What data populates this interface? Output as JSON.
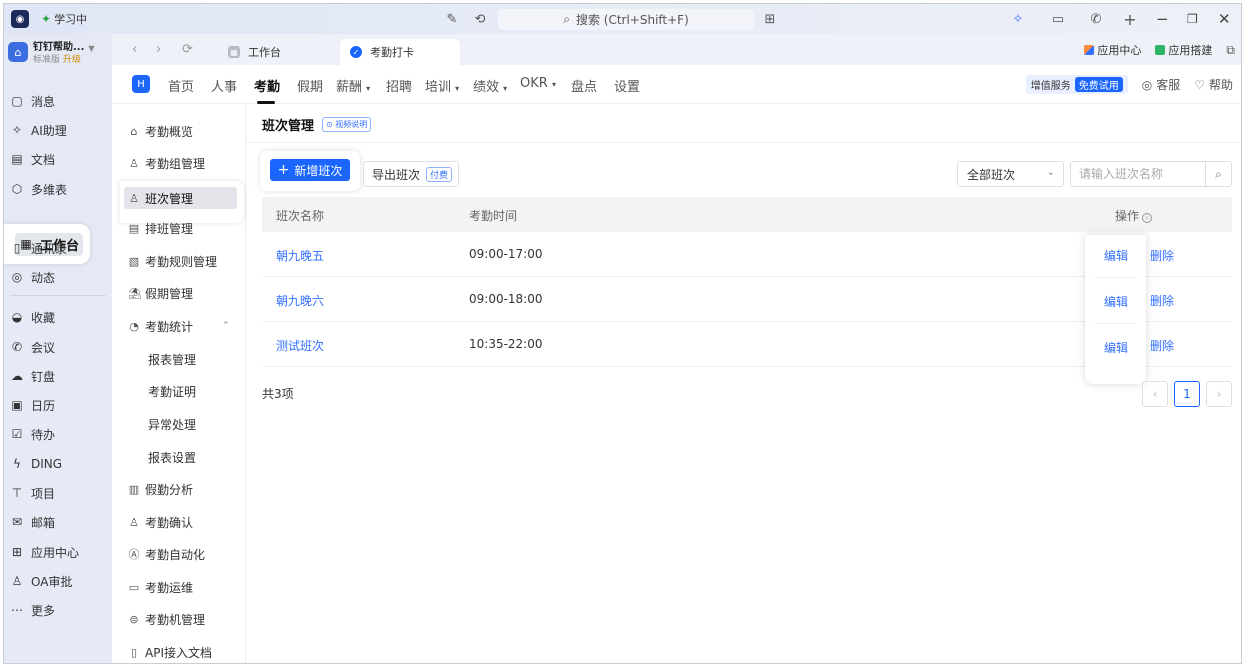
{
  "titlebar": {
    "study_label": "学习中",
    "search_text": "搜索 (Ctrl+Shift+F)"
  },
  "org": {
    "name": "钉钉帮助...",
    "plan": "标准版",
    "upgrade": "升级"
  },
  "leftnav": {
    "items": [
      {
        "label": "消息",
        "icon": "chat-icon"
      },
      {
        "label": "AI助理",
        "icon": "ai-spark-icon"
      },
      {
        "label": "文档",
        "icon": "doc-icon"
      },
      {
        "label": "多维表",
        "icon": "table-icon"
      },
      {
        "label": "工作台",
        "icon": "grid-icon"
      },
      {
        "label": "通讯录",
        "icon": "contacts-icon"
      },
      {
        "label": "动态",
        "icon": "activity-icon"
      },
      {
        "label": "收藏",
        "icon": "bookmark-icon"
      },
      {
        "label": "会议",
        "icon": "meeting-icon"
      },
      {
        "label": "钉盘",
        "icon": "cloud-icon"
      },
      {
        "label": "日历",
        "icon": "calendar-icon"
      },
      {
        "label": "待办",
        "icon": "todo-icon"
      },
      {
        "label": "DING",
        "icon": "ding-icon"
      },
      {
        "label": "项目",
        "icon": "project-icon"
      },
      {
        "label": "邮箱",
        "icon": "mail-icon"
      },
      {
        "label": "应用中心",
        "icon": "apps-icon"
      },
      {
        "label": "OA审批",
        "icon": "approval-icon"
      },
      {
        "label": "更多",
        "icon": "more-icon"
      }
    ]
  },
  "tabs": [
    {
      "label": "工作台"
    },
    {
      "label": "考勤打卡"
    }
  ],
  "tabs_right": {
    "app_center": "应用中心",
    "app_builder": "应用搭建"
  },
  "modnav": {
    "items": [
      "首页",
      "人事",
      "考勤",
      "假期",
      "薪酬",
      "招聘",
      "培训",
      "绩效",
      "OKR",
      "盘点",
      "设置"
    ],
    "value_added": "增值服务",
    "free_trial": "免费试用",
    "service": "客服",
    "help": "帮助"
  },
  "subnav": {
    "items": [
      {
        "label": "考勤概览",
        "icon": "home-icon"
      },
      {
        "label": "考勤组管理",
        "icon": "group-icon"
      },
      {
        "label": "班次管理",
        "icon": "shift-icon"
      },
      {
        "label": "排班管理",
        "icon": "schedule-icon"
      },
      {
        "label": "考勤规则管理",
        "icon": "rule-icon"
      },
      {
        "label": "假期管理",
        "icon": "holiday-icon"
      },
      {
        "label": "考勤统计",
        "icon": "stats-icon"
      },
      {
        "label": "报表管理"
      },
      {
        "label": "考勤证明"
      },
      {
        "label": "异常处理"
      },
      {
        "label": "报表设置"
      },
      {
        "label": "假勤分析",
        "icon": "analysis-icon"
      },
      {
        "label": "考勤确认",
        "icon": "confirm-icon"
      },
      {
        "label": "考勤自动化",
        "icon": "automation-icon"
      },
      {
        "label": "考勤运维",
        "icon": "ops-icon"
      },
      {
        "label": "考勤机管理",
        "icon": "device-icon"
      },
      {
        "label": "API接入文档",
        "icon": "api-icon"
      }
    ]
  },
  "content": {
    "title": "班次管理",
    "video_link": "⊙ 视频说明",
    "add_button": "新增班次",
    "export_button": "导出班次",
    "paid_tag": "付费",
    "filter_value": "全部班次",
    "search_placeholder": "请输入班次名称",
    "columns": {
      "name": "班次名称",
      "time": "考勤时间",
      "ops": "操作"
    },
    "rows": [
      {
        "name": "朝九晚五",
        "time": "09:00-17:00",
        "edit": "编辑",
        "delete": "删除"
      },
      {
        "name": "朝九晚六",
        "time": "09:00-18:00",
        "edit": "编辑",
        "delete": "删除"
      },
      {
        "name": "测试班次",
        "time": "10:35-22:00",
        "edit": "编辑",
        "delete": "删除"
      }
    ],
    "total": "共3项",
    "page": "1"
  }
}
